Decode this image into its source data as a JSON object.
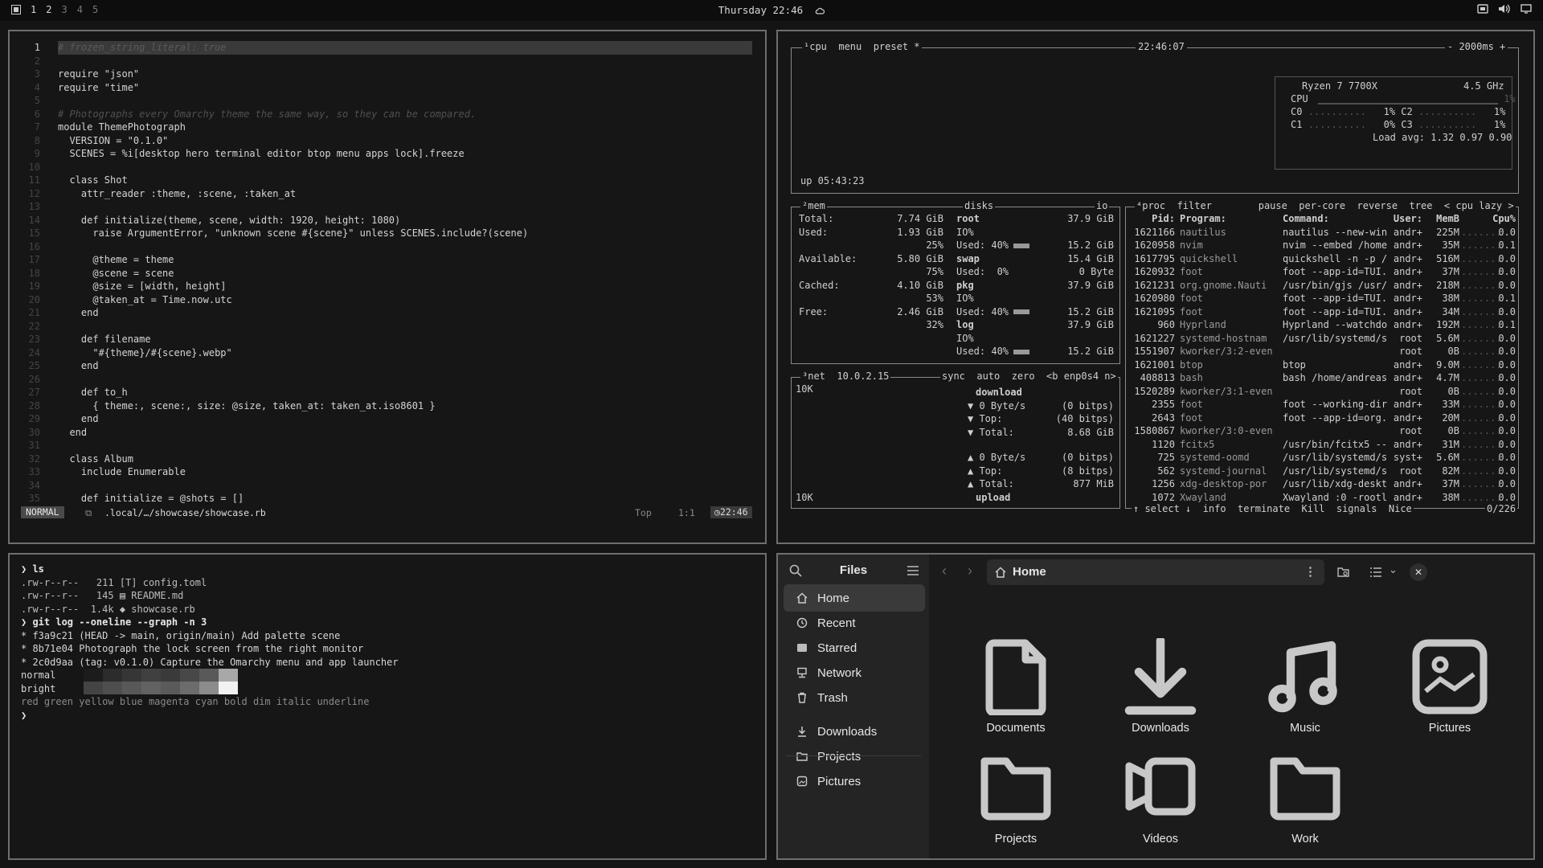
{
  "topbar": {
    "workspaces": [
      "1",
      "2",
      "3",
      "4",
      "5"
    ],
    "clock": "Thursday 22:46"
  },
  "editor": {
    "lines": [
      {
        "n": "1",
        "t": "# frozen_string_literal: true"
      },
      {
        "n": "2",
        "t": ""
      },
      {
        "n": "3",
        "t": "require \"json\""
      },
      {
        "n": "4",
        "t": "require \"time\""
      },
      {
        "n": "5",
        "t": ""
      },
      {
        "n": "6",
        "t": "# Photographs every Omarchy theme the same way, so they can be compared."
      },
      {
        "n": "7",
        "t": "module ThemePhotograph"
      },
      {
        "n": "8",
        "t": "  VERSION = \"0.1.0\""
      },
      {
        "n": "9",
        "t": "  SCENES = %i[desktop hero terminal editor btop menu apps lock].freeze"
      },
      {
        "n": "10",
        "t": ""
      },
      {
        "n": "11",
        "t": "  class Shot"
      },
      {
        "n": "12",
        "t": "    attr_reader :theme, :scene, :taken_at"
      },
      {
        "n": "13",
        "t": ""
      },
      {
        "n": "14",
        "t": "    def initialize(theme, scene, width: 1920, height: 1080)"
      },
      {
        "n": "15",
        "t": "      raise ArgumentError, \"unknown scene #{scene}\" unless SCENES.include?(scene)"
      },
      {
        "n": "16",
        "t": ""
      },
      {
        "n": "17",
        "t": "      @theme = theme"
      },
      {
        "n": "18",
        "t": "      @scene = scene"
      },
      {
        "n": "19",
        "t": "      @size = [width, height]"
      },
      {
        "n": "20",
        "t": "      @taken_at = Time.now.utc"
      },
      {
        "n": "21",
        "t": "    end"
      },
      {
        "n": "22",
        "t": ""
      },
      {
        "n": "23",
        "t": "    def filename"
      },
      {
        "n": "24",
        "t": "      \"#{theme}/#{scene}.webp\""
      },
      {
        "n": "25",
        "t": "    end"
      },
      {
        "n": "26",
        "t": ""
      },
      {
        "n": "27",
        "t": "    def to_h"
      },
      {
        "n": "28",
        "t": "      { theme:, scene:, size: @size, taken_at: taken_at.iso8601 }"
      },
      {
        "n": "29",
        "t": "    end"
      },
      {
        "n": "30",
        "t": "  end"
      },
      {
        "n": "31",
        "t": ""
      },
      {
        "n": "32",
        "t": "  class Album"
      },
      {
        "n": "33",
        "t": "    include Enumerable"
      },
      {
        "n": "34",
        "t": ""
      },
      {
        "n": "35",
        "t": "    def initialize = @shots = []"
      }
    ],
    "status": {
      "mode": "NORMAL",
      "path": ".local/…/showcase/showcase.rb",
      "pos": "Top",
      "cursor": "1:1",
      "time": "22:46"
    }
  },
  "btop": {
    "header": {
      "tabs": "¹cpu  menu  preset *",
      "clock": "22:46:07",
      "rate": "- 2000ms +"
    },
    "cpu": {
      "model": "Ryzen 7 7700X",
      "freq": "4.5 GHz",
      "rows": [
        "CPU",
        "C0",
        "C1"
      ],
      "uptime": "up 05:43:23",
      "load": "Load avg: 1.32 0.97 0.90"
    },
    "mem": [
      {
        "k": "Total:",
        "v": "7.74 GiB"
      },
      {
        "k": "Used:",
        "v": "1.93 GiB"
      },
      {
        "k": "",
        "v": "25%"
      },
      {
        "k": "Available:",
        "v": "5.80 GiB"
      },
      {
        "k": "",
        "v": "75%"
      },
      {
        "k": "Cached:",
        "v": "4.10 GiB"
      },
      {
        "k": "",
        "v": "53%"
      },
      {
        "k": "Free:",
        "v": "2.46 GiB"
      },
      {
        "k": "",
        "v": "32%"
      }
    ],
    "disks": [
      {
        "k": "root",
        "v": "37.9 GiB"
      },
      {
        "k": "IO%",
        "v": ""
      },
      {
        "k": "Used: 40%",
        "v": "15.2 GiB"
      },
      {
        "k": "swap",
        "v": "15.4 GiB"
      },
      {
        "k": "Used:  0%",
        "v": "0 Byte"
      },
      {
        "k": "pkg",
        "v": "37.9 GiB"
      },
      {
        "k": "IO%",
        "v": ""
      },
      {
        "k": "Used: 40%",
        "v": "15.2 GiB"
      },
      {
        "k": "log",
        "v": "37.9 GiB"
      },
      {
        "k": "IO%",
        "v": ""
      },
      {
        "k": "Used: 40%",
        "v": "15.2 GiB"
      }
    ],
    "net": {
      "title": "net",
      "ip": "10.0.2.15",
      "opts": "sync  auto  zero  <b enp0s4 n>",
      "scale": "10K",
      "down": [
        {
          "k": "download",
          "v": ""
        },
        {
          "k": "▼ 0 Byte/s",
          "v": "(0 bitps)"
        },
        {
          "k": "▼ Top:",
          "v": "(40 bitps)"
        },
        {
          "k": "▼ Total:",
          "v": "8.68 GiB"
        }
      ],
      "up": [
        {
          "k": "▲ 0 Byte/s",
          "v": "(0 bitps)"
        },
        {
          "k": "▲ Top:",
          "v": "(8 bitps)"
        },
        {
          "k": "▲ Total:",
          "v": "877 MiB"
        },
        {
          "k": "upload",
          "v": ""
        }
      ]
    },
    "proc": {
      "title": "⁴proc  filter        pause  per-core  reverse  tree  < cpu lazy >",
      "header": [
        "Pid:",
        "Program:",
        "Command:",
        "User:",
        "MemB",
        "Cpu%"
      ],
      "rows": [
        [
          "1621166",
          "nautilus",
          "nautilus --new-win",
          "andr+",
          "225M",
          "0.0"
        ],
        [
          "1620958",
          "nvim",
          "nvim --embed /home",
          "andr+",
          "35M",
          "0.1"
        ],
        [
          "1617795",
          "quickshell",
          "quickshell -n -p /",
          "andr+",
          "516M",
          "0.0"
        ],
        [
          "1620932",
          "foot",
          "foot --app-id=TUI.",
          "andr+",
          "37M",
          "0.0"
        ],
        [
          "1621231",
          "org.gnome.Nauti",
          "/usr/bin/gjs /usr/",
          "andr+",
          "218M",
          "0.0"
        ],
        [
          "1620980",
          "foot",
          "foot --app-id=TUI.",
          "andr+",
          "38M",
          "0.1"
        ],
        [
          "1621095",
          "foot",
          "foot --app-id=TUI.",
          "andr+",
          "34M",
          "0.0"
        ],
        [
          "960",
          "Hyprland",
          "Hyprland --watchdo",
          "andr+",
          "192M",
          "0.1"
        ],
        [
          "1621227",
          "systemd-hostnam",
          "/usr/lib/systemd/s",
          "root",
          "5.6M",
          "0.0"
        ],
        [
          "1551907",
          "kworker/3:2-even",
          "",
          "root",
          "0B",
          "0.0"
        ],
        [
          "1621001",
          "btop",
          "btop",
          "andr+",
          "9.0M",
          "0.0"
        ],
        [
          "408813",
          "bash",
          "bash /home/andreas",
          "andr+",
          "4.7M",
          "0.0"
        ],
        [
          "1520289",
          "kworker/3:1-even",
          "",
          "root",
          "0B",
          "0.0"
        ],
        [
          "2355",
          "foot",
          "foot --working-dir",
          "andr+",
          "33M",
          "0.0"
        ],
        [
          "2643",
          "foot",
          "foot --app-id=org.",
          "andr+",
          "20M",
          "0.0"
        ],
        [
          "1580867",
          "kworker/3:0-even",
          "",
          "root",
          "0B",
          "0.0"
        ],
        [
          "1120",
          "fcitx5",
          "/usr/bin/fcitx5 --",
          "andr+",
          "31M",
          "0.0"
        ],
        [
          "725",
          "systemd-oomd",
          "/usr/lib/systemd/s",
          "syst+",
          "5.6M",
          "0.0"
        ],
        [
          "562",
          "systemd-journal",
          "/usr/lib/systemd/s",
          "root",
          "82M",
          "0.0"
        ],
        [
          "1256",
          "xdg-desktop-por",
          "/usr/lib/xdg-deskt",
          "andr+",
          "37M",
          "0.0"
        ],
        [
          "1072",
          "Xwayland",
          "Xwayland :0 -rootl",
          "andr+",
          "38M",
          "0.0"
        ]
      ],
      "footer": "↑ select ↓  info  terminate  Kill  signals  Nice",
      "count": "0/226"
    }
  },
  "terminal": {
    "lines": [
      "❯ ls",
      ".rw-r--r--   211 [T] config.toml",
      ".rw-r--r--   145 ▤ README.md",
      ".rw-r--r--  1.4k ◆ showcase.rb",
      "❯ git log --oneline --graph -n 3",
      "* f3a9c21 (HEAD -> main, origin/main) Add palette scene",
      "* 8b71e04 Photograph the lock screen from the right monitor",
      "* 2c0d9aa (tag: v0.1.0) Capture the Omarchy menu and app launcher",
      "normal",
      "bright",
      "red green yellow blue magenta cyan bold dim italic underline",
      "❯"
    ]
  },
  "files": {
    "title": "Files",
    "location": "Home",
    "sidebar": [
      {
        "label": "Home",
        "icon": "home-icon",
        "active": true
      },
      {
        "label": "Recent",
        "icon": "clock-icon"
      },
      {
        "label": "Starred",
        "icon": "star-icon"
      },
      {
        "label": "Network",
        "icon": "network-icon"
      },
      {
        "label": "Trash",
        "icon": "trash-icon"
      },
      {
        "label": "Downloads",
        "icon": "download-icon"
      },
      {
        "label": "Projects",
        "icon": "folder-icon"
      },
      {
        "label": "Pictures",
        "icon": "picture-icon"
      }
    ],
    "items": [
      {
        "label": "Documents",
        "icon": "document-icon"
      },
      {
        "label": "Downloads",
        "icon": "download-icon"
      },
      {
        "label": "Music",
        "icon": "music-icon"
      },
      {
        "label": "Pictures",
        "icon": "picture-icon"
      },
      {
        "label": "Projects",
        "icon": "folder-icon"
      },
      {
        "label": "Videos",
        "icon": "video-icon"
      },
      {
        "label": "Work",
        "icon": "folder-icon"
      }
    ]
  },
  "colors": {
    "bg": "#141414",
    "border": "#6e6e6e",
    "sidebar": "#242424",
    "text": "#e6e6e6"
  }
}
